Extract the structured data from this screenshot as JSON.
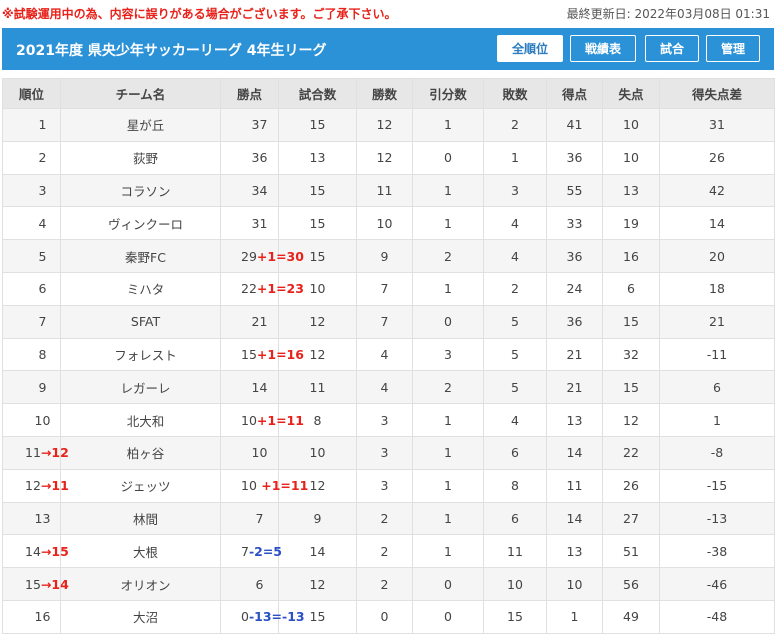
{
  "notice": "※試験運用中の為、内容に誤りがある場合がございます。ご了承下さい。",
  "last_updated": "最終更新日: 2022年03月08日 01:31",
  "title": "2021年度 県央少年サッカーリーグ 4年生リーグ",
  "nav": [
    {
      "label": "全順位",
      "active": true
    },
    {
      "label": "戦績表",
      "active": false
    },
    {
      "label": "試合",
      "active": false
    },
    {
      "label": "管理",
      "active": false
    }
  ],
  "colors": {
    "header": "#2b92d8",
    "notice": "#e8221b",
    "adjust_up": "#e8221b",
    "adjust_down": "#2a4fc6"
  },
  "columns": [
    "順位",
    "チーム名",
    "勝点",
    "試合数",
    "勝数",
    "引分数",
    "敗数",
    "得点",
    "失点",
    "得失点差"
  ],
  "rows": [
    {
      "rank": "1",
      "rank_change": "",
      "team": "星が丘",
      "points": "37",
      "points_adj": "",
      "played": "15",
      "won": "12",
      "drawn": "1",
      "lost": "2",
      "gf": "41",
      "ga": "10",
      "gd": "31"
    },
    {
      "rank": "2",
      "rank_change": "",
      "team": "荻野",
      "points": "36",
      "points_adj": "",
      "played": "13",
      "won": "12",
      "drawn": "0",
      "lost": "1",
      "gf": "36",
      "ga": "10",
      "gd": "26"
    },
    {
      "rank": "3",
      "rank_change": "",
      "team": "コラソン",
      "points": "34",
      "points_adj": "",
      "played": "15",
      "won": "11",
      "drawn": "1",
      "lost": "3",
      "gf": "55",
      "ga": "13",
      "gd": "42"
    },
    {
      "rank": "4",
      "rank_change": "",
      "team": "ヴィンクーロ",
      "points": "31",
      "points_adj": "",
      "played": "15",
      "won": "10",
      "drawn": "1",
      "lost": "4",
      "gf": "33",
      "ga": "19",
      "gd": "14"
    },
    {
      "rank": "5",
      "rank_change": "",
      "team": "秦野FC",
      "points": "29",
      "points_adj": "+1=30",
      "played": "15",
      "won": "9",
      "drawn": "2",
      "lost": "4",
      "gf": "36",
      "ga": "16",
      "gd": "20"
    },
    {
      "rank": "6",
      "rank_change": "",
      "team": "ミハタ",
      "points": "22",
      "points_adj": "+1=23",
      "played": "10",
      "won": "7",
      "drawn": "1",
      "lost": "2",
      "gf": "24",
      "ga": "6",
      "gd": "18"
    },
    {
      "rank": "7",
      "rank_change": "",
      "team": "SFAT",
      "points": "21",
      "points_adj": "",
      "played": "12",
      "won": "7",
      "drawn": "0",
      "lost": "5",
      "gf": "36",
      "ga": "15",
      "gd": "21"
    },
    {
      "rank": "8",
      "rank_change": "",
      "team": "フォレスト",
      "points": "15",
      "points_adj": "+1=16",
      "played": "12",
      "won": "4",
      "drawn": "3",
      "lost": "5",
      "gf": "21",
      "ga": "32",
      "gd": "-11"
    },
    {
      "rank": "9",
      "rank_change": "",
      "team": "レガーレ",
      "points": "14",
      "points_adj": "",
      "played": "11",
      "won": "4",
      "drawn": "2",
      "lost": "5",
      "gf": "21",
      "ga": "15",
      "gd": "6"
    },
    {
      "rank": "10",
      "rank_change": "",
      "team": "北大和",
      "points": "10",
      "points_adj": "+1=11",
      "played": "8",
      "won": "3",
      "drawn": "1",
      "lost": "4",
      "gf": "13",
      "ga": "12",
      "gd": "1"
    },
    {
      "rank": "11",
      "rank_change": "→12",
      "team": "柏ヶ谷",
      "points": "10",
      "points_adj": "",
      "played": "10",
      "won": "3",
      "drawn": "1",
      "lost": "6",
      "gf": "14",
      "ga": "22",
      "gd": "-8"
    },
    {
      "rank": "12",
      "rank_change": "→11",
      "team": "ジェッツ",
      "points": "10",
      "points_adj": " +1=11",
      "played": "12",
      "won": "3",
      "drawn": "1",
      "lost": "8",
      "gf": "11",
      "ga": "26",
      "gd": "-15"
    },
    {
      "rank": "13",
      "rank_change": "",
      "team": "林間",
      "points": "7",
      "points_adj": "",
      "played": "9",
      "won": "2",
      "drawn": "1",
      "lost": "6",
      "gf": "14",
      "ga": "27",
      "gd": "-13"
    },
    {
      "rank": "14",
      "rank_change": "→15",
      "team": "大根",
      "points": "7",
      "points_adj": "-2=5",
      "played": "14",
      "won": "2",
      "drawn": "1",
      "lost": "11",
      "gf": "13",
      "ga": "51",
      "gd": "-38"
    },
    {
      "rank": "15",
      "rank_change": "→14",
      "team": "オリオン",
      "points": "6",
      "points_adj": "",
      "played": "12",
      "won": "2",
      "drawn": "0",
      "lost": "10",
      "gf": "10",
      "ga": "56",
      "gd": "-46"
    },
    {
      "rank": "16",
      "rank_change": "",
      "team": "大沼",
      "points": "0",
      "points_adj": "-13=-13",
      "played": "15",
      "won": "0",
      "drawn": "0",
      "lost": "15",
      "gf": "1",
      "ga": "49",
      "gd": "-48"
    }
  ]
}
